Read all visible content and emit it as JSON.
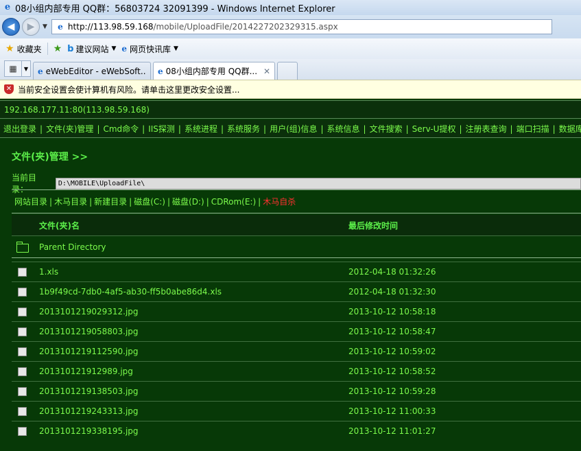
{
  "window": {
    "title": "08小组内部专用 QQ群：56803724 32091399 - Windows Internet Explorer"
  },
  "address": {
    "url_host": "http://113.98.59.168",
    "url_path": "/mobile/UploadFile/2014227202329315.aspx"
  },
  "favorites": {
    "favorites_label": "收藏夹",
    "suggested_sites": "建议网站",
    "web_slice": "网页快讯库"
  },
  "tabs": [
    {
      "title": "eWebEditor - eWebSoft...",
      "active": false
    },
    {
      "title": "08小组内部专用 QQ群...",
      "active": true
    }
  ],
  "infobar": {
    "message": "当前安全设置会使计算机有风险。请单击这里更改安全设置..."
  },
  "page": {
    "host": "192.168.177.11:80(113.98.59.168)",
    "menu": [
      "退出登录",
      "文件(夹)管理",
      "Cmd命令",
      "IIS探测",
      "系统进程",
      "系统服务",
      "用户(组)信息",
      "系统信息",
      "文件搜索",
      "Serv-U提权",
      "注册表查询",
      "端口扫描",
      "数据库管理"
    ],
    "section_title": "文件(夹)管理 >>",
    "current_dir_label": "当前目录：",
    "current_dir_value": "D:\\MOBILE\\UploadFile\\",
    "links": [
      {
        "label": "网站目录",
        "color": "#7cfc4c"
      },
      {
        "label": "木马目录",
        "color": "#7cfc4c"
      },
      {
        "label": "新建目录",
        "color": "#7cfc4c"
      },
      {
        "label": "磁盘(C:)",
        "color": "#7cfc4c"
      },
      {
        "label": "磁盘(D:)",
        "color": "#7cfc4c"
      },
      {
        "label": "CDRom(E:)",
        "color": "#7cfc4c"
      },
      {
        "label": "木马自杀",
        "color": "#ff3030"
      }
    ],
    "table": {
      "col_name": "文件(夹)名",
      "col_time": "最后修改时间",
      "parent_dir": "Parent Directory",
      "files": [
        {
          "name": "1.xls",
          "time": "2012-04-18 01:32:26"
        },
        {
          "name": "1b9f49cd-7db0-4af5-ab30-ff5b0abe86d4.xls",
          "time": "2012-04-18 01:32:30"
        },
        {
          "name": "2013101219029312.jpg",
          "time": "2013-10-12 10:58:18"
        },
        {
          "name": "2013101219058803.jpg",
          "time": "2013-10-12 10:58:47"
        },
        {
          "name": "2013101219112590.jpg",
          "time": "2013-10-12 10:59:02"
        },
        {
          "name": "201310121912989.jpg",
          "time": "2013-10-12 10:58:52"
        },
        {
          "name": "2013101219138503.jpg",
          "time": "2013-10-12 10:59:28"
        },
        {
          "name": "2013101219243313.jpg",
          "time": "2013-10-12 11:00:33"
        },
        {
          "name": "2013101219338195.jpg",
          "time": "2013-10-12 11:01:27"
        }
      ]
    }
  }
}
